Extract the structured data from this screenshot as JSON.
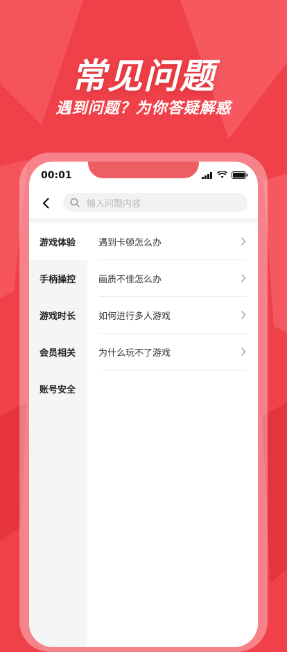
{
  "hero": {
    "title": "常见问题",
    "subtitle": "遇到问题？为你答疑解惑"
  },
  "status_bar": {
    "time": "00:01"
  },
  "search": {
    "placeholder": "输入问题内容"
  },
  "sidebar": {
    "items": [
      {
        "label": "游戏体验",
        "active": true
      },
      {
        "label": "手柄操控",
        "active": false
      },
      {
        "label": "游戏时长",
        "active": false
      },
      {
        "label": "会员相关",
        "active": false
      },
      {
        "label": "账号安全",
        "active": false
      }
    ]
  },
  "faq": {
    "items": [
      {
        "question": "遇到卡顿怎么办"
      },
      {
        "question": "画质不佳怎么办"
      },
      {
        "question": "如何进行多人游戏"
      },
      {
        "question": "为什么玩不了游戏"
      }
    ]
  },
  "colors": {
    "brand_red": "#f0414a",
    "sidebar_bg": "#f5f5f5"
  }
}
